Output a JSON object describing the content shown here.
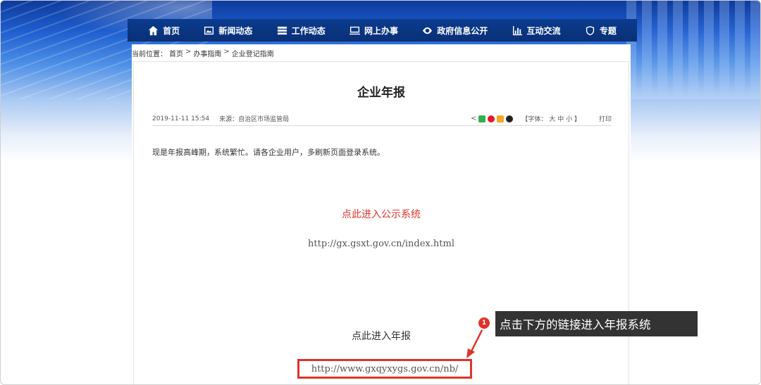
{
  "nav": {
    "items": [
      {
        "label": "首页",
        "icon": "home-icon"
      },
      {
        "label": "新闻动态",
        "icon": "image-icon"
      },
      {
        "label": "工作动态",
        "icon": "stack-icon"
      },
      {
        "label": "网上办事",
        "icon": "monitor-icon"
      },
      {
        "label": "政府信息公开",
        "icon": "eye-icon"
      },
      {
        "label": "互动交流",
        "icon": "bar-chart-icon"
      },
      {
        "label": "专题",
        "icon": "shield-icon"
      }
    ]
  },
  "breadcrumb": {
    "prefix": "当前位置：",
    "items": [
      "首页",
      "办事指南",
      "企业登记指南"
    ],
    "separator": ">"
  },
  "article": {
    "title": "企业年报",
    "date": "2019-11-11 15:54",
    "source": "来源：自治区市场监管局",
    "font_label_open": "【字体：",
    "font_large": "大",
    "font_medium": "中",
    "font_small": "小",
    "font_label_close": "】",
    "print": "打印",
    "body": "现是年报高峰期，系统繁忙。请各企业用户，多刷新页面登录系统。",
    "public_link": "点此进入公示系统",
    "public_url": "http://gx.gsxt.gov.cn/index.html",
    "annual_link": "点此进入年报",
    "annual_url": "http://www.gxqyxygs.gov.cn/nb/"
  },
  "annotation": {
    "badge": "1",
    "text": "点击下方的链接进入年报系统"
  },
  "colors": {
    "accent_red": "#e0332b",
    "nav_bg": "#0b3c8f",
    "callout_bg": "#333333"
  }
}
